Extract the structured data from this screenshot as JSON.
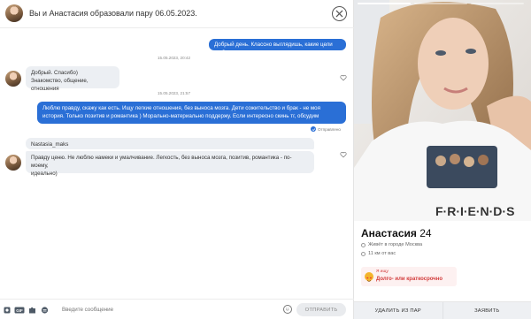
{
  "header": {
    "title": "Вы и Анастасия образовали пару 06.05.2023."
  },
  "messages": [
    {
      "id": "m1",
      "dir": "out",
      "text": "Добрый день. Классно выглядишь, какие цели тут?"
    },
    {
      "id": "t1",
      "kind": "timestamp",
      "text": "15.05.2023, 20:42"
    },
    {
      "id": "m2",
      "dir": "in",
      "lines": [
        "Добрый. Спасибо)",
        "Знакомство, общение, отношения"
      ]
    },
    {
      "id": "t2",
      "kind": "timestamp",
      "text": "15.05.2023, 21:57"
    },
    {
      "id": "m3",
      "dir": "out",
      "lines": [
        "Люблю правду, скажу как есть. Ищу легкие отношения, без выноса мозга. Дети сожительство и брак - не моя",
        "история. Только позитив и романтика ) Морально-материально поддержу. Если интересно скинь тг, обсудим"
      ]
    },
    {
      "id": "s3",
      "kind": "status",
      "text": "Отправлено"
    },
    {
      "id": "m4",
      "dir": "in",
      "lines": [
        "Nastasia_maks"
      ]
    },
    {
      "id": "m5",
      "dir": "in",
      "lines": [
        "Правду ценю. Не люблю намеки и умалчивание. Легкость, без выноса мозга, позитив, романтика - по-моему,",
        "идеально)"
      ]
    }
  ],
  "input": {
    "placeholder": "Введите сообщение",
    "send_label": "ОТПРАВИТЬ",
    "icons": [
      "sticker-icon",
      "gif-icon",
      "puzzle-icon",
      "sticker2-icon"
    ]
  },
  "profile": {
    "name": "Анастасия",
    "age": "24",
    "city": "Живёт в городе Москва",
    "distance": "11 км от вас",
    "seek_small": "Я ищу",
    "seek_main": "Долго- или краткосрочно",
    "remove_label": "УДАЛИТЬ ИЗ ПАР",
    "report_label": "ЗАЯВИТЬ",
    "photo_count": 3,
    "photo_index": 1
  },
  "colors": {
    "accent": "#2a6fd6",
    "bubble_in": "#eceff3",
    "seek_text": "#d23a3a"
  }
}
